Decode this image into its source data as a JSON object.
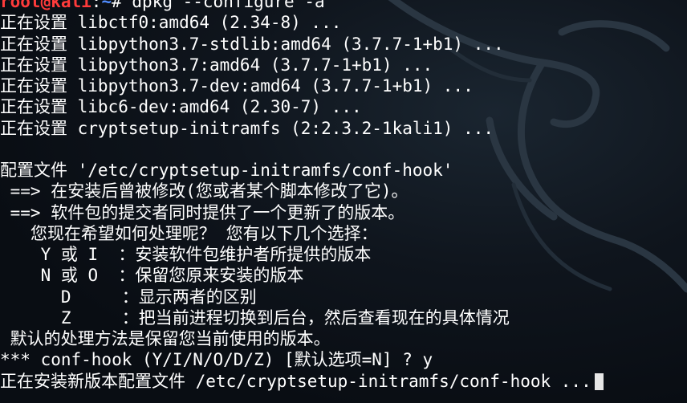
{
  "prompt": {
    "user": "root@kali",
    "separator": ":",
    "path": "~",
    "symbol": "#",
    "command": " dpkg --configure -a"
  },
  "output_lines": [
    "正在设置 libctf0:amd64 (2.34-8) ...",
    "正在设置 libpython3.7-stdlib:amd64 (3.7.7-1+b1) ...",
    "正在设置 libpython3.7:amd64 (3.7.7-1+b1) ...",
    "正在设置 libpython3.7-dev:amd64 (3.7.7-1+b1) ...",
    "正在设置 libc6-dev:amd64 (2.30-7) ...",
    "正在设置 cryptsetup-initramfs (2:2.3.2-1kali1) ...",
    "",
    "配置文件 '/etc/cryptsetup-initramfs/conf-hook'",
    " ==> 在安装后曾被修改(您或者某个脚本修改了它)。",
    " ==> 软件包的提交者同时提供了一个更新了的版本。",
    "   您现在希望如何处理呢？ 您有以下几个选择：",
    "    Y 或 I  ：安装软件包维护者所提供的版本",
    "    N 或 O  ：保留您原来安装的版本",
    "      D     ：显示两者的区别",
    "      Z     ：把当前进程切换到后台，然后查看现在的具体情况",
    " 默认的处理方法是保留您当前使用的版本。",
    "*** conf-hook (Y/I/N/O/D/Z) [默认选项=N] ? y",
    "正在安装新版本配置文件 /etc/cryptsetup-initramfs/conf-hook ..."
  ],
  "colors": {
    "background": "#0b0f16",
    "text": "#ffffff",
    "prompt_user": "#ff3b3b",
    "prompt_path": "#4f8cff",
    "cursor": "#e6e6e6"
  },
  "icons": [
    "kali-dragon-watermark-icon",
    "terminal-cursor-icon"
  ]
}
